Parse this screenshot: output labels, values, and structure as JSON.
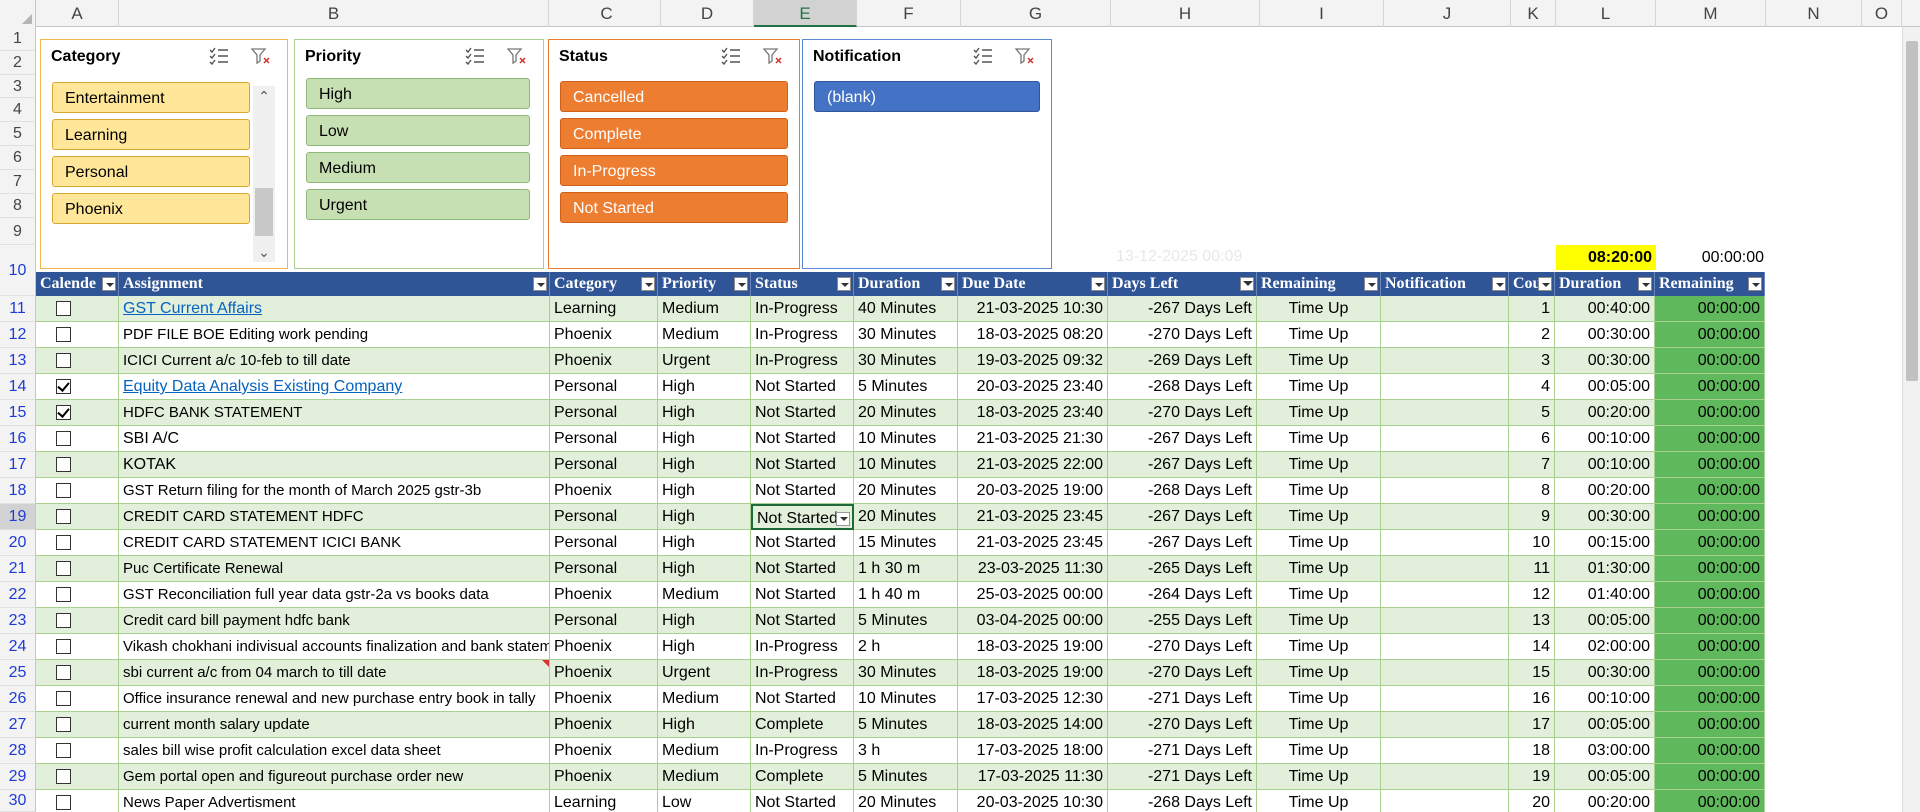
{
  "columns": [
    "A",
    "B",
    "C",
    "D",
    "E",
    "F",
    "G",
    "H",
    "I",
    "J",
    "K",
    "L",
    "M",
    "N",
    "O"
  ],
  "selected_column": "E",
  "rows": [
    "1",
    "2",
    "3",
    "4",
    "5",
    "6",
    "7",
    "8",
    "9",
    "10",
    "11",
    "12",
    "13",
    "14",
    "15",
    "16",
    "17",
    "18",
    "19",
    "20",
    "21",
    "22",
    "23",
    "24",
    "25",
    "26",
    "27",
    "28",
    "29",
    "30"
  ],
  "selected_row": "19",
  "slicers": {
    "category": {
      "title": "Category",
      "items": [
        "Entertainment",
        "Learning",
        "Personal",
        "Phoenix"
      ]
    },
    "priority": {
      "title": "Priority",
      "items": [
        "High",
        "Low",
        "Medium",
        "Urgent"
      ]
    },
    "status": {
      "title": "Status",
      "items": [
        "Cancelled",
        "Complete",
        "In-Progress",
        "Not Started"
      ]
    },
    "notification": {
      "title": "Notification",
      "items": [
        "(blank)"
      ]
    }
  },
  "top_cells": {
    "faded_date": "13-12-2025 00:09",
    "total_duration": "08:20:00",
    "total_remaining": "00:00:00"
  },
  "headers": [
    "Calende",
    "Assignment",
    "Category",
    "Priority",
    "Status",
    "Duration",
    "Due Date",
    "Days Left",
    "Remaining",
    "Notification",
    "Cou",
    "Duration",
    "Remaining"
  ],
  "table": [
    {
      "checked": false,
      "assignment": "GST Current Affairs",
      "category": "Learning",
      "priority": "Medium",
      "status": "In-Progress",
      "duration": "40 Minutes",
      "due": "21-03-2025 10:30",
      "days_left": "-267 Days Left",
      "remaining": "Time Up",
      "count": "1",
      "dur2": "00:40:00",
      "rem2": "00:00:00"
    },
    {
      "checked": false,
      "assignment": "PDF FILE BOE Editing work pending",
      "category": "Phoenix",
      "priority": "Medium",
      "status": "In-Progress",
      "duration": "30 Minutes",
      "due": "18-03-2025 08:20",
      "days_left": "-270 Days Left",
      "remaining": "Time Up",
      "count": "2",
      "dur2": "00:30:00",
      "rem2": "00:00:00"
    },
    {
      "checked": false,
      "assignment": "ICICI Current a/c 10-feb to till date",
      "category": "Phoenix",
      "priority": "Urgent",
      "status": "In-Progress",
      "duration": "30 Minutes",
      "due": "19-03-2025 09:32",
      "days_left": "-269 Days Left",
      "remaining": "Time Up",
      "count": "3",
      "dur2": "00:30:00",
      "rem2": "00:00:00"
    },
    {
      "checked": true,
      "assignment": "Equity Data Analysis Existing Company",
      "category": "Personal",
      "priority": "High",
      "status": "Not Started",
      "duration": "5 Minutes",
      "due": "20-03-2025 23:40",
      "days_left": "-268 Days Left",
      "remaining": "Time Up",
      "count": "4",
      "dur2": "00:05:00",
      "rem2": "00:00:00"
    },
    {
      "checked": true,
      "assignment": "HDFC BANK STATEMENT",
      "category": "Personal",
      "priority": "High",
      "status": "Not Started",
      "duration": "20 Minutes",
      "due": "18-03-2025 23:40",
      "days_left": "-270 Days Left",
      "remaining": "Time Up",
      "count": "5",
      "dur2": "00:20:00",
      "rem2": "00:00:00"
    },
    {
      "checked": false,
      "assignment": "SBI A/C",
      "category": "Personal",
      "priority": "High",
      "status": "Not Started",
      "duration": "10 Minutes",
      "due": "21-03-2025 21:30",
      "days_left": "-267 Days Left",
      "remaining": "Time Up",
      "count": "6",
      "dur2": "00:10:00",
      "rem2": "00:00:00"
    },
    {
      "checked": false,
      "assignment": "KOTAK",
      "category": "Personal",
      "priority": "High",
      "status": "Not Started",
      "duration": "10 Minutes",
      "due": "21-03-2025 22:00",
      "days_left": "-267 Days Left",
      "remaining": "Time Up",
      "count": "7",
      "dur2": "00:10:00",
      "rem2": "00:00:00"
    },
    {
      "checked": false,
      "assignment": "GST Return filing for the month of March 2025 gstr-3b",
      "category": "Phoenix",
      "priority": "High",
      "status": "Not Started",
      "duration": "20 Minutes",
      "due": "20-03-2025 19:00",
      "days_left": "-268 Days Left",
      "remaining": "Time Up",
      "count": "8",
      "dur2": "00:20:00",
      "rem2": "00:00:00"
    },
    {
      "checked": false,
      "assignment": "CREDIT CARD STATEMENT HDFC",
      "category": "Personal",
      "priority": "High",
      "status": "Not Started",
      "duration": "20 Minutes",
      "due": "21-03-2025 23:45",
      "days_left": "-267 Days Left",
      "remaining": "Time Up",
      "count": "9",
      "dur2": "00:30:00",
      "rem2": "00:00:00"
    },
    {
      "checked": false,
      "assignment": "CREDIT CARD STATEMENT ICICI BANK",
      "category": "Personal",
      "priority": "High",
      "status": "Not Started",
      "duration": "15 Minutes",
      "due": "21-03-2025 23:45",
      "days_left": "-267 Days Left",
      "remaining": "Time Up",
      "count": "10",
      "dur2": "00:15:00",
      "rem2": "00:00:00"
    },
    {
      "checked": false,
      "assignment": "Puc Certificate Renewal",
      "category": "Personal",
      "priority": "High",
      "status": "Not Started",
      "duration": "1 h 30 m",
      "due": "23-03-2025 11:30",
      "days_left": "-265 Days Left",
      "remaining": "Time Up",
      "count": "11",
      "dur2": "01:30:00",
      "rem2": "00:00:00"
    },
    {
      "checked": false,
      "assignment": "GST Reconciliation full year data gstr-2a vs books data",
      "category": "Phoenix",
      "priority": "Medium",
      "status": "Not Started",
      "duration": "1 h 40 m",
      "due": "25-03-2025 00:00",
      "days_left": "-264 Days Left",
      "remaining": "Time Up",
      "count": "12",
      "dur2": "01:40:00",
      "rem2": "00:00:00"
    },
    {
      "checked": false,
      "assignment": "Credit card bill payment hdfc bank",
      "category": "Personal",
      "priority": "High",
      "status": "Not Started",
      "duration": "5 Minutes",
      "due": "03-04-2025 00:00",
      "days_left": "-255 Days Left",
      "remaining": "Time Up",
      "count": "13",
      "dur2": "00:05:00",
      "rem2": "00:00:00"
    },
    {
      "checked": false,
      "assignment": "Vikash chokhani indivisual accounts finalization and bank statement u",
      "category": "Phoenix",
      "priority": "High",
      "status": "In-Progress",
      "duration": "2 h",
      "due": "18-03-2025 19:00",
      "days_left": "-270 Days Left",
      "remaining": "Time Up",
      "count": "14",
      "dur2": "02:00:00",
      "rem2": "00:00:00"
    },
    {
      "checked": false,
      "assignment": "sbi current a/c from 04 march to till date",
      "category": "Phoenix",
      "priority": "Urgent",
      "status": "In-Progress",
      "duration": "30 Minutes",
      "due": "18-03-2025 19:00",
      "days_left": "-270 Days Left",
      "remaining": "Time Up",
      "count": "15",
      "dur2": "00:30:00",
      "rem2": "00:00:00"
    },
    {
      "checked": false,
      "assignment": "Office insurance renewal and new purchase entry book in tally",
      "category": "Phoenix",
      "priority": "Medium",
      "status": "Not Started",
      "duration": "10 Minutes",
      "due": "17-03-2025 12:30",
      "days_left": "-271 Days Left",
      "remaining": "Time Up",
      "count": "16",
      "dur2": "00:10:00",
      "rem2": "00:00:00"
    },
    {
      "checked": false,
      "assignment": "current month salary update",
      "category": "Phoenix",
      "priority": "High",
      "status": "Complete",
      "duration": "5 Minutes",
      "due": "18-03-2025 14:00",
      "days_left": "-270 Days Left",
      "remaining": "Time Up",
      "count": "17",
      "dur2": "00:05:00",
      "rem2": "00:00:00"
    },
    {
      "checked": false,
      "assignment": "sales bill wise profit calculation excel data sheet",
      "category": "Phoenix",
      "priority": "Medium",
      "status": "In-Progress",
      "duration": "3 h",
      "due": "17-03-2025 18:00",
      "days_left": "-271 Days Left",
      "remaining": "Time Up",
      "count": "18",
      "dur2": "03:00:00",
      "rem2": "00:00:00"
    },
    {
      "checked": false,
      "assignment": "Gem portal open and figureout purchase order new",
      "category": "Phoenix",
      "priority": "Medium",
      "status": "Complete",
      "duration": "5 Minutes",
      "due": "17-03-2025 11:30",
      "days_left": "-271 Days Left",
      "remaining": "Time Up",
      "count": "19",
      "dur2": "00:05:00",
      "rem2": "00:00:00"
    },
    {
      "checked": false,
      "assignment": "News Paper Advertisment",
      "category": "Learning",
      "priority": "Low",
      "status": "Not Started",
      "duration": "20 Minutes",
      "due": "20-03-2025 10:30",
      "days_left": "-268 Days Left",
      "remaining": "Time Up",
      "count": "20",
      "dur2": "00:20:00",
      "rem2": "00:00:00"
    }
  ]
}
